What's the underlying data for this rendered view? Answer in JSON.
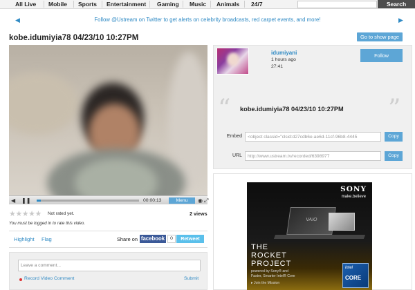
{
  "nav": {
    "items": [
      "All Live",
      "Mobile",
      "Sports",
      "Entertainment",
      "Gaming",
      "Music",
      "Animals",
      "24/7"
    ],
    "search_label": "Search"
  },
  "banner": {
    "text": "Follow @Ustream on Twitter to get alerts on celebrity broadcasts, red carpet events, and more!"
  },
  "video": {
    "title": "kobe.idumiyia78 04/23/10 10:27PM",
    "show_page_label": "Go to show page",
    "time": "00:00:13",
    "menu_label": "Menu",
    "progress": 0.04
  },
  "stats": {
    "rating_text": "Not rated yet.",
    "views": "2 views",
    "login_note": "You must be logged in to rate this video."
  },
  "social": {
    "highlight": "Highlight",
    "flag": "Flag",
    "share_on": "Share on",
    "facebook": "facebook",
    "count": "0",
    "retweet": "Retweet"
  },
  "comment": {
    "placeholder": "Leave a comment...",
    "record": "Record Video Comment",
    "submit": "Submit"
  },
  "channel": {
    "username": "idumiyani",
    "ago": "1 hours ago",
    "duration": "27:41",
    "follow": "Follow",
    "quote": "kobe.idumiyia78 04/23/10 10:27PM",
    "embed_label": "Embed",
    "embed_value": "<object classid=\"clsid:d27cdb6e-ae6d-11cf-96b8-4445",
    "url_label": "URL",
    "url_value": "http://www.ustream.tv/recorded/6398977",
    "copy": "Copy"
  },
  "ad": {
    "brand": "SONY",
    "tagline": "make.believe",
    "laptop_text": "VAIO",
    "headline1": "THE",
    "headline2": "ROCKET",
    "headline3": "PROJECT",
    "line1": "powered by Sony® and",
    "line2": "Faster, Smarter Intel® Core",
    "line3": "▸ Join the Mission",
    "intel1": "intel",
    "intel2": "CORE"
  }
}
